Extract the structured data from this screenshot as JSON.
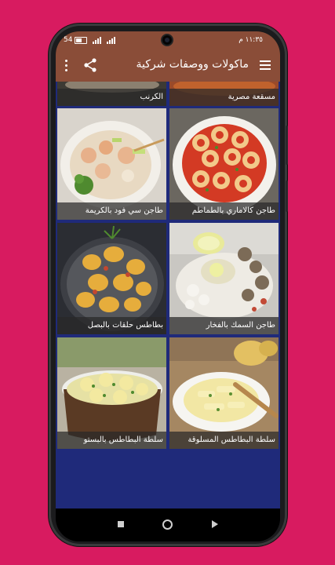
{
  "status_bar": {
    "time": "١١:٣٥ م",
    "battery": "54"
  },
  "app_bar": {
    "title": "ماكولات ووصفات شركية"
  },
  "recipes": [
    {
      "label": "الكرنب"
    },
    {
      "label": "مسقعة مصرية"
    },
    {
      "label": "طاجن سي فود بالكريمة"
    },
    {
      "label": "طاجن كالاماري بالطماطم"
    },
    {
      "label": "بطاطس حلقات بالبصل"
    },
    {
      "label": "طاجن السمك بالفخار"
    },
    {
      "label": "سلطة البطاطس بالبستو"
    },
    {
      "label": "سلطة البطاطس المسلوقة"
    }
  ],
  "colors": {
    "background": "#d81b60",
    "app_bar": "#8a4d38",
    "list_bg": "#1f2a7a"
  },
  "icons": [
    "hamburger-menu-icon",
    "share-icon",
    "more-vert-icon",
    "battery-icon",
    "signal-icon",
    "nav-recents-icon",
    "nav-home-icon",
    "nav-back-icon"
  ]
}
